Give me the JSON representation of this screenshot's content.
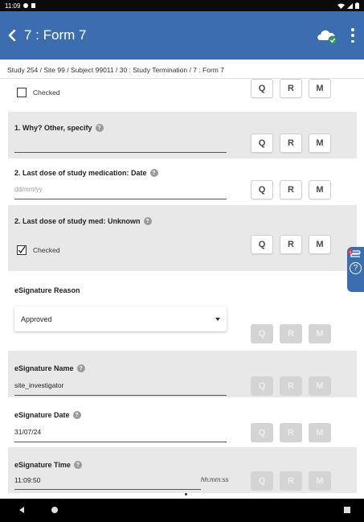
{
  "status_bar": {
    "time": "11:09"
  },
  "header": {
    "title": "7 : Form 7"
  },
  "breadcrumb": "Study 254 / Site 99 / Subject 99011 / 30 : Study Termination / 7 : Form 7",
  "query_buttons": {
    "q": "Q",
    "r": "R",
    "m": "M"
  },
  "help_glyph": "?",
  "sections": [
    {
      "type": "checkbox",
      "checkbox_label": "Checked",
      "checked": false
    },
    {
      "type": "text",
      "label": "1. Why? Other, specify",
      "value": ""
    },
    {
      "type": "date",
      "label": "2. Last dose of study medication: Date",
      "placeholder": "dd/mm/yy",
      "value": ""
    },
    {
      "type": "checkbox",
      "label": "2. Last dose of study med: Unknown",
      "checkbox_label": "Checked",
      "checked": true
    },
    {
      "type": "select",
      "label": "eSignature Reason",
      "selected": "Approved",
      "disabled_buttons": true
    },
    {
      "type": "text",
      "label": "eSignature Name",
      "value": "site_investigator",
      "disabled_buttons": true
    },
    {
      "type": "text",
      "label": "eSignature Date",
      "value": "31/07/24",
      "disabled_buttons": true
    },
    {
      "type": "time",
      "label": "eSignature Time",
      "value": "11:09:50",
      "hint": "hh:mm:ss",
      "disabled_buttons": true
    }
  ],
  "side_tab": {
    "badge": "0",
    "help_glyph": "?"
  },
  "colors": {
    "app_bar": "#3c6db0",
    "row_grey": "#e8e8e8",
    "disabled_button": "#d4d4d4",
    "cloud_check": "#2e9e4f"
  },
  "icons": [
    "back-chevron-icon",
    "cloud-sync-icon",
    "more-vert-icon",
    "help-circle-icon",
    "checkbox-icon",
    "dropdown-caret-icon",
    "paperclip-icon"
  ]
}
